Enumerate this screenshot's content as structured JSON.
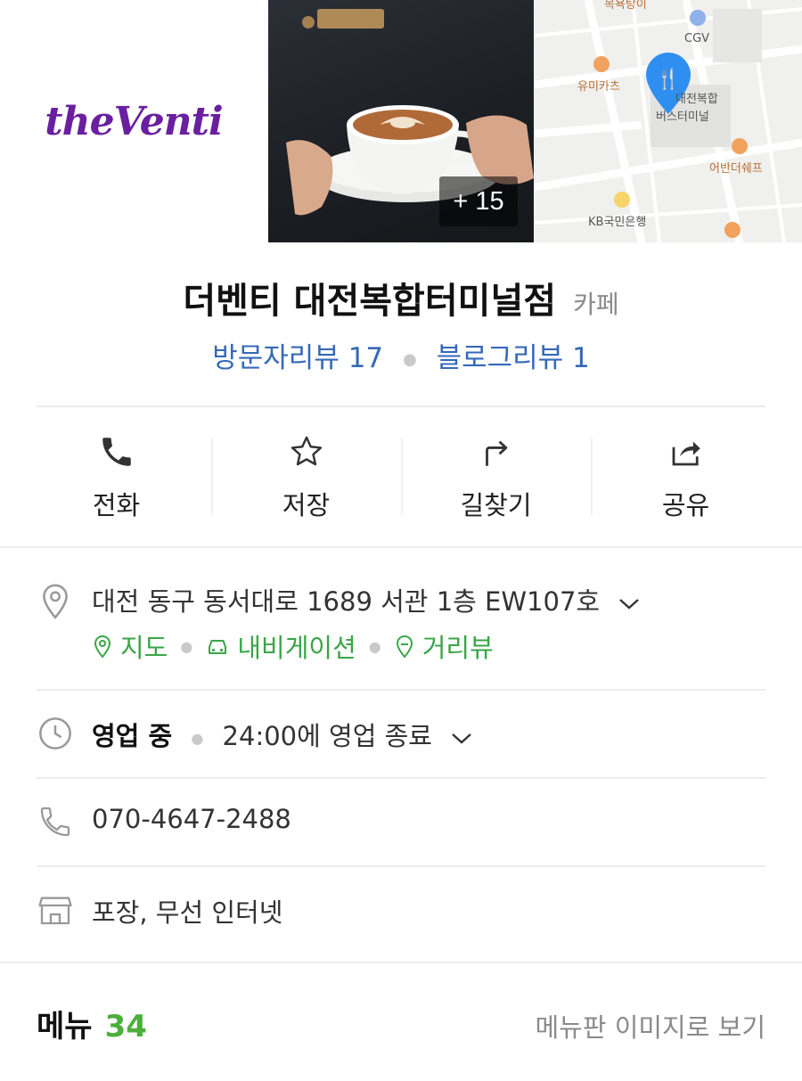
{
  "hero": {
    "logo_text": "theVenti",
    "photo_more_count": "+ 15",
    "map_labels": [
      "유미카츠",
      "CGV",
      "대전복합",
      "버스터미널",
      "어반더쉐프",
      "KB국민은행",
      "목욕탕이"
    ]
  },
  "place": {
    "name": "더벤티 대전복합터미널점",
    "category": "카페",
    "visitor_reviews": "방문자리뷰 17",
    "blog_reviews": "블로그리뷰 1"
  },
  "actions": [
    {
      "label": "전화",
      "icon": "phone-icon"
    },
    {
      "label": "저장",
      "icon": "star-icon"
    },
    {
      "label": "길찾기",
      "icon": "directions-icon"
    },
    {
      "label": "공유",
      "icon": "share-icon"
    }
  ],
  "info": {
    "address": "대전 동구 동서대로 1689 서관 1층 EW107호",
    "links": {
      "map": "지도",
      "navigation": "내비게이션",
      "streetview": "거리뷰"
    },
    "status": "영업 중",
    "hours": "24:00에 영업 종료",
    "phone": "070-4647-2488",
    "amenities": "포장, 무선 인터넷"
  },
  "menu": {
    "title": "메뉴",
    "count": "34",
    "board_link": "메뉴판 이미지로 보기"
  },
  "colors": {
    "brand": "#6a1fa0",
    "link_blue": "#3569b8",
    "green": "#3aa548",
    "map_pin": "#2f8ff0"
  }
}
